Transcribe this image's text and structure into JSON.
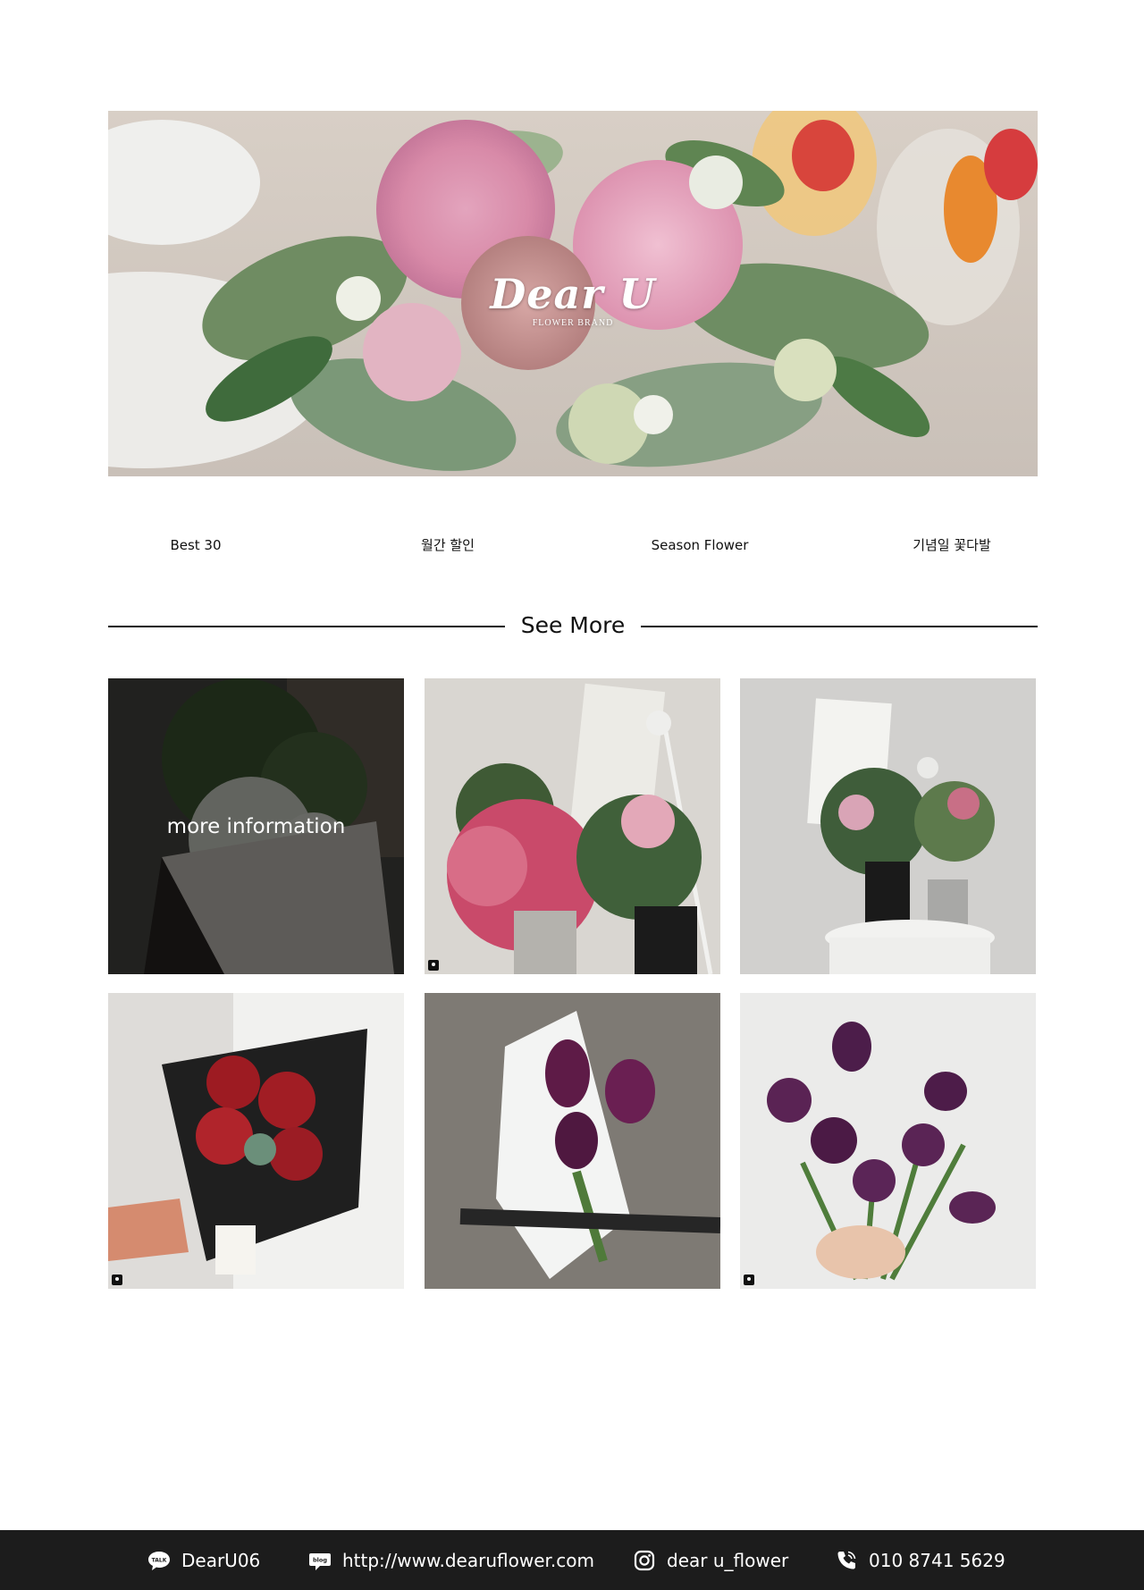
{
  "hero": {
    "brand_name": "Dear U",
    "brand_sub": "FLOWER BRAND",
    "image": "peony-bouquet-table-photo"
  },
  "categories": [
    {
      "label": "Best 30"
    },
    {
      "label": "월간 할인"
    },
    {
      "label": "Season Flower"
    },
    {
      "label": "기념일 꽃다발"
    }
  ],
  "see_more": {
    "label": "See More"
  },
  "gallery": {
    "hover_text": "more information",
    "tiles": [
      {
        "subject": "dark-bouquet-photo"
      },
      {
        "subject": "roses-and-lilies-in-vases-photo"
      },
      {
        "subject": "lilies-on-stool-photo"
      },
      {
        "subject": "red-roses-bouquet-photo"
      },
      {
        "subject": "purple-tulips-wrapped-photo"
      },
      {
        "subject": "purple-tulips-in-hand-photo"
      }
    ]
  },
  "footer": {
    "kakao": {
      "icon": "talk-bubble-icon",
      "text": "DearU06"
    },
    "blog": {
      "icon": "blog-bubble-icon",
      "text": "http://www.dearuflower.com"
    },
    "instagram": {
      "icon": "instagram-icon",
      "text": "dear u_flower"
    },
    "phone": {
      "icon": "phone-icon",
      "text": "010 8741 5629"
    }
  },
  "colors": {
    "footer_bg": "#1c1c1c",
    "text": "#111111",
    "overlay": "#000000"
  }
}
